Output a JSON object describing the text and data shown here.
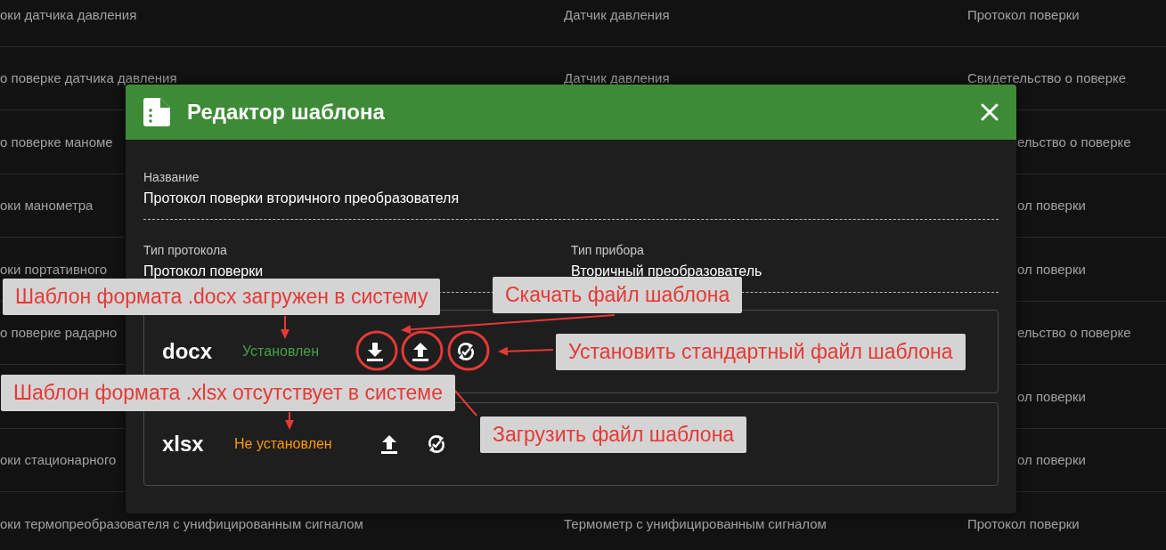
{
  "table": {
    "rows": [
      {
        "column_1": "оки датчика давления",
        "column_2": "Датчик давления",
        "column_3": "Протокол поверки"
      },
      {
        "column_1": "о поверке датчика давления",
        "column_2": "Датчик давления",
        "column_3": "Свидетельство о поверке"
      },
      {
        "column_1": "о поверке маноме",
        "column_3": "ельство о поверке"
      },
      {
        "column_1": "оки манометра",
        "column_3": "ол поверки"
      },
      {
        "column_1": "оки портативного",
        "column_3": "ол поверки"
      },
      {
        "column_1": "о поверке радарно",
        "column_3": "ельство о поверке"
      },
      {
        "column_3": "ол поверки"
      },
      {
        "column_1": "оки стационарного",
        "column_3": "ол поверки"
      },
      {
        "column_1": "оки термопреобразователя с унифицированным сигналом",
        "column_2": "Термометр с унифицированным сигналом",
        "column_3": "Протокол поверки"
      }
    ]
  },
  "dialog": {
    "title": "Редактор шаблона",
    "name_field": {
      "label": "Название",
      "value": "Протокол поверки вторичного преобразователя"
    },
    "fields": [
      {
        "label": "Тип протокола",
        "value": "Протокол поверки"
      },
      {
        "label": "Тип прибора",
        "value": "Вторичный преобразователь"
      }
    ],
    "templates": [
      {
        "format": "docx",
        "status": "Установлен",
        "installed": true,
        "actions": [
          {
            "kind": "download"
          },
          {
            "kind": "upload"
          },
          {
            "kind": "reset"
          }
        ]
      },
      {
        "format": "xlsx",
        "status": "Не установлен",
        "installed": false,
        "actions": [
          {
            "kind": "upload"
          },
          {
            "kind": "reset"
          }
        ]
      }
    ]
  },
  "annotations": [
    {
      "text": "Шаблон формата .docx загружен в систему"
    },
    {
      "text": "Скачать файл шаблона"
    },
    {
      "text": "Установить стандартный файл шаблона"
    },
    {
      "text": "Шаблон формата .xlsx отсутствует в системе"
    },
    {
      "text": "Загрузить файл шаблона"
    }
  ]
}
